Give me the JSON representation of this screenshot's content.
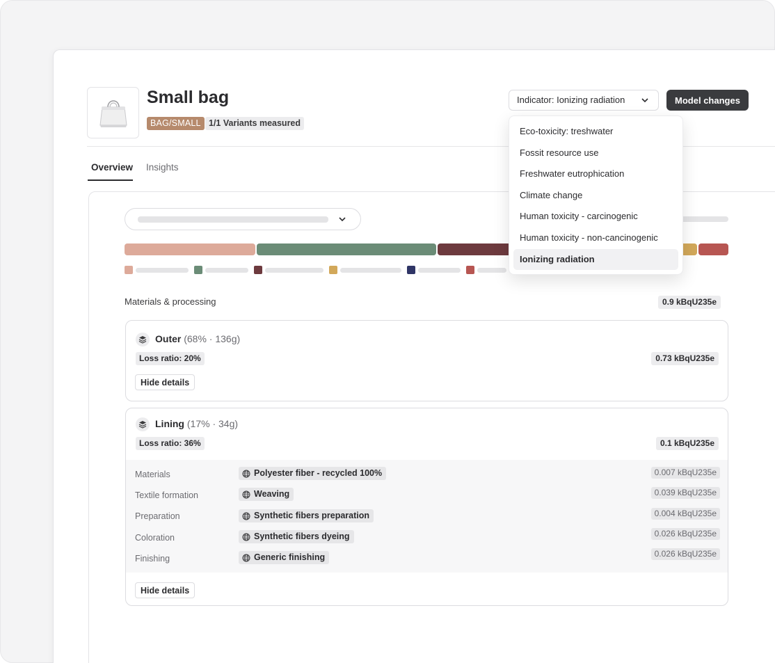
{
  "product": {
    "title": "Small bag",
    "sku_tag": "BAG/SMALL",
    "variants_tag": "1/1 Variants measured",
    "image_icon": "handbag-icon"
  },
  "header": {
    "indicator_label": "Indicator: Ionizing radiation",
    "model_changes_label": "Model changes"
  },
  "tabs": [
    {
      "label": "Overview",
      "active": true
    },
    {
      "label": "Insights",
      "active": false
    }
  ],
  "impact_bar": {
    "segments_colors": [
      "#ddaa9a",
      "#6b8c77",
      "#6d3a3e",
      "#d2a85a",
      "#b75652"
    ],
    "legend_colors": [
      "#ddaa9a",
      "#6b8c77",
      "#6d3a3e",
      "#d2a85a",
      "#2f3566",
      "#b75652"
    ]
  },
  "materials_section": {
    "label": "Materials & processing",
    "total": "0.9 kBqU235e"
  },
  "components": [
    {
      "name": "Outer",
      "meta": "(68% · 136g)",
      "loss_ratio": "Loss ratio: 20%",
      "value": "0.73 kBqU235e",
      "hide_label": "Hide details"
    },
    {
      "name": "Lining",
      "meta": "(17% · 34g)",
      "loss_ratio": "Loss ratio: 36%",
      "value": "0.1 kBqU235e",
      "hide_label": "Hide details",
      "steps": [
        {
          "label": "Materials",
          "chip": "Polyester fiber - recycled 100%",
          "value": "0.007 kBqU235e"
        },
        {
          "label": "Textile formation",
          "chip": "Weaving",
          "value": "0.039 kBqU235e"
        },
        {
          "label": "Preparation",
          "chip": "Synthetic fibers preparation",
          "value": "0.004 kBqU235e"
        },
        {
          "label": "Coloration",
          "chip": "Synthetic fibers dyeing",
          "value": "0.026 kBqU235e"
        },
        {
          "label": "Finishing",
          "chip": "Generic finishing",
          "value": "0.026 kBqU235e"
        }
      ]
    }
  ],
  "indicator_menu": {
    "items": [
      "Eco-toxicity: treshwater",
      "Fossit resource use",
      "Freshwater eutrophication",
      "Climate change",
      "Human toxicity - carcinogenic",
      "Human toxicity - non-cancinogenic",
      "Ionizing radiation"
    ],
    "selected": "Ionizing radiation"
  }
}
